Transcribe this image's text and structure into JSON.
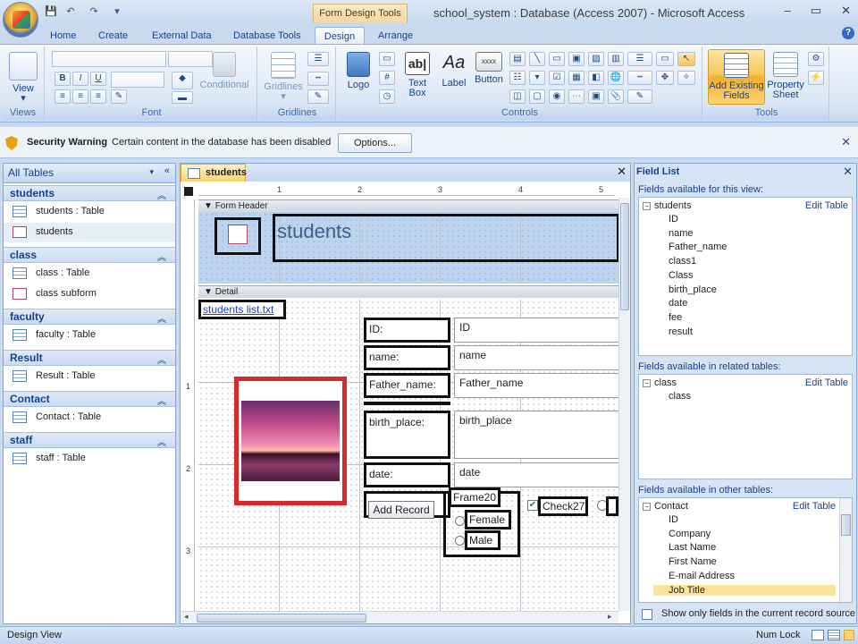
{
  "app": {
    "window_title": "school_system : Database (Access 2007) - Microsoft Access",
    "contextual_tab_title": "Form Design Tools",
    "window_controls": [
      "–",
      "▭",
      "✕"
    ],
    "help": "?"
  },
  "quick_access": [
    "💾",
    "↶",
    "↷",
    "▾"
  ],
  "ribbon_tabs": [
    "Home",
    "Create",
    "External Data",
    "Database Tools",
    "Design",
    "Arrange"
  ],
  "active_tab": "Design",
  "ribbon": {
    "views": {
      "label": "Views",
      "view_button": "View"
    },
    "font": {
      "label": "Font",
      "bold": "B",
      "italic": "I",
      "underline": "U",
      "conditional": "Conditional"
    },
    "gridlines": {
      "label": "Gridlines",
      "button": "Gridlines"
    },
    "controls": {
      "label": "Controls",
      "logo": "Logo",
      "text_box": "Text Box",
      "label_btn": "Label",
      "button": "Button"
    },
    "tools": {
      "label": "Tools",
      "add_existing_fields": "Add Existing Fields",
      "property_sheet": "Property Sheet"
    }
  },
  "security": {
    "title": "Security Warning",
    "message": "Certain content in the database has been disabled",
    "options_button": "Options..."
  },
  "nav": {
    "header": "All Tables",
    "groups": [
      {
        "name": "students",
        "items": [
          {
            "label": "students : Table",
            "kind": "table"
          },
          {
            "label": "students",
            "kind": "form"
          }
        ]
      },
      {
        "name": "class",
        "items": [
          {
            "label": "class : Table",
            "kind": "table"
          },
          {
            "label": "class subform",
            "kind": "form"
          }
        ]
      },
      {
        "name": "faculty",
        "items": [
          {
            "label": "faculty : Table",
            "kind": "table"
          }
        ]
      },
      {
        "name": "Result",
        "items": [
          {
            "label": "Result : Table",
            "kind": "table"
          }
        ]
      },
      {
        "name": "Contact",
        "items": [
          {
            "label": "Contact : Table",
            "kind": "table"
          }
        ]
      },
      {
        "name": "staff",
        "items": [
          {
            "label": "staff : Table",
            "kind": "table"
          }
        ]
      }
    ]
  },
  "document": {
    "tab_title": "students",
    "form_header_label": "Form Header",
    "header_title": "students",
    "detail_label": "Detail",
    "hyperlink": "students list.txt",
    "ruler_h": [
      "1",
      "2",
      "3",
      "4",
      "5"
    ],
    "ruler_v": [
      "1",
      "2",
      "3"
    ],
    "fields": [
      {
        "label": "ID:",
        "control": "ID"
      },
      {
        "label": "name:",
        "control": "name"
      },
      {
        "label": "Father_name:",
        "control": "Father_name"
      },
      {
        "label": "birth_place:",
        "control": "birth_place"
      },
      {
        "label": "date:",
        "control": "date"
      }
    ],
    "add_record_button": "Add Record",
    "frame_label": "Frame20",
    "option_female": "Female",
    "option_male": "Male",
    "check_label": "Check27"
  },
  "field_list": {
    "title": "Field List",
    "section_this_view": "Fields available for this view:",
    "section_related": "Fields available in related tables:",
    "section_other": "Fields available in other tables:",
    "edit_table": "Edit Table",
    "this_view": {
      "table": "students",
      "fields": [
        "ID",
        "name",
        "Father_name",
        "class1",
        "Class",
        "birth_place",
        "date",
        "fee",
        "result"
      ]
    },
    "related": {
      "table": "class",
      "fields": [
        "class"
      ]
    },
    "other": {
      "table": "Contact",
      "fields": [
        "ID",
        "Company",
        "Last Name",
        "First Name",
        "E-mail Address",
        "Job Title"
      ]
    },
    "footer": "Show only fields in the current record source"
  },
  "status": {
    "left": "Design View",
    "num_lock": "Num Lock"
  }
}
